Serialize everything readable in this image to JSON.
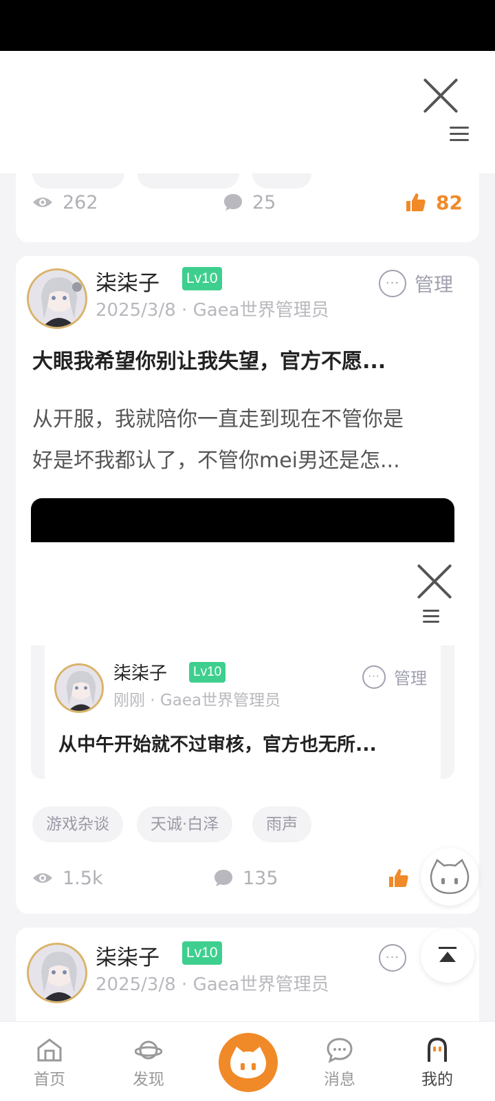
{
  "post1": {
    "views": "262",
    "comments": "25",
    "likes": "82"
  },
  "post2": {
    "author": "柒柒子",
    "level": "Lv10",
    "meta": "2025/3/8 · Gaea世界管理员",
    "manage_label": "管理",
    "title": "大眼我希望你别让我失望，官方不愿...",
    "body_line1": "从开服，我就陪你一直走到现在不管你是",
    "body_line2": "好是坏我都认了，不管你mei男还是怎...",
    "embed": {
      "author": "柒柒子",
      "level": "Lv10",
      "meta": "刚刚 · Gaea世界管理员",
      "manage_label": "管理",
      "title": "从中午开始就不过审核，官方也无所..."
    },
    "tags": [
      "游戏杂谈",
      "天诚·白泽",
      "雨声"
    ],
    "views": "1.5k",
    "comments": "135"
  },
  "post3": {
    "author": "柒柒子",
    "level": "Lv10",
    "meta": "2025/3/8 · Gaea世界管理员"
  },
  "nav": {
    "home": "首页",
    "discover": "发现",
    "messages": "消息",
    "mine": "我的"
  },
  "colors": {
    "accent": "#f08a28",
    "level_badge": "#3ecf8e"
  }
}
